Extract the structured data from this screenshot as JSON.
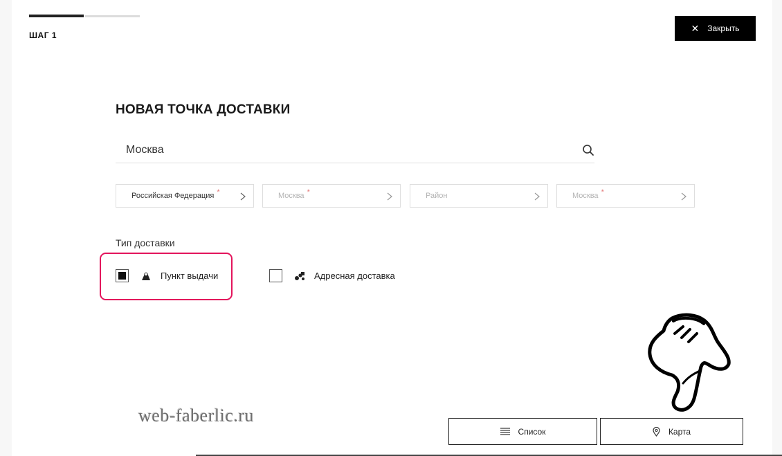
{
  "step": {
    "label": "ШАГ 1",
    "current": 1,
    "total": 2
  },
  "close_button": {
    "label": "Закрыть",
    "icon": "close-icon"
  },
  "title": "НОВАЯ ТОЧКА ДОСТАВКИ",
  "search": {
    "value": "Москва",
    "icon": "search-icon"
  },
  "breadcrumbs": [
    {
      "label": "Российская Федерация",
      "required": "*",
      "filled": true
    },
    {
      "label": "Москва",
      "required": "*",
      "filled": false
    },
    {
      "label": "Район",
      "required": "",
      "filled": false
    },
    {
      "label": "Москва",
      "required": "*",
      "filled": false
    }
  ],
  "delivery_type": {
    "label": "Тип доставки",
    "options": [
      {
        "label": "Пункт выдачи",
        "icon": "pickup-point-icon",
        "checked": true
      },
      {
        "label": "Адресная доставка",
        "icon": "courier-delivery-icon",
        "checked": false
      }
    ]
  },
  "view_buttons": {
    "list": {
      "label": "Список",
      "icon": "list-icon"
    },
    "map": {
      "label": "Карта",
      "icon": "location-pin-icon"
    }
  },
  "watermark": "web-faberlic.ru",
  "colors": {
    "accent": "#e3145c",
    "primary": "#000000",
    "required_star": "#e47a7a"
  }
}
